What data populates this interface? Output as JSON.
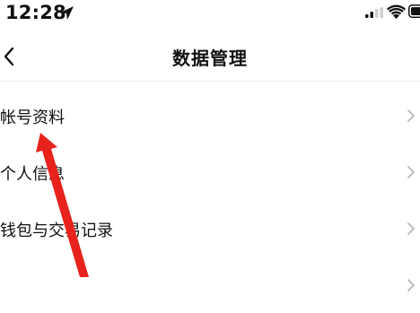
{
  "status_bar": {
    "time": "12:28",
    "icons": [
      "location-arrow-icon",
      "cellular-signal-icon",
      "wifi-icon",
      "battery-icon"
    ]
  },
  "nav": {
    "title": "数据管理",
    "back_icon": "chevron-left-icon"
  },
  "menu": {
    "items": [
      {
        "label": "帐号资料",
        "icon": "chevron-right-icon"
      },
      {
        "label": "个人信息",
        "icon": "chevron-right-icon"
      },
      {
        "label": "钱包与交易记录",
        "icon": "chevron-right-icon"
      },
      {
        "label": "",
        "icon": "chevron-right-icon"
      }
    ]
  },
  "annotation": {
    "type": "red-arrow",
    "color": "#e8231d",
    "points_to": "帐号资料"
  },
  "colors": {
    "text": "#111111",
    "chevron": "#b5b5b5",
    "divider": "#ececec",
    "background": "#ffffff"
  }
}
